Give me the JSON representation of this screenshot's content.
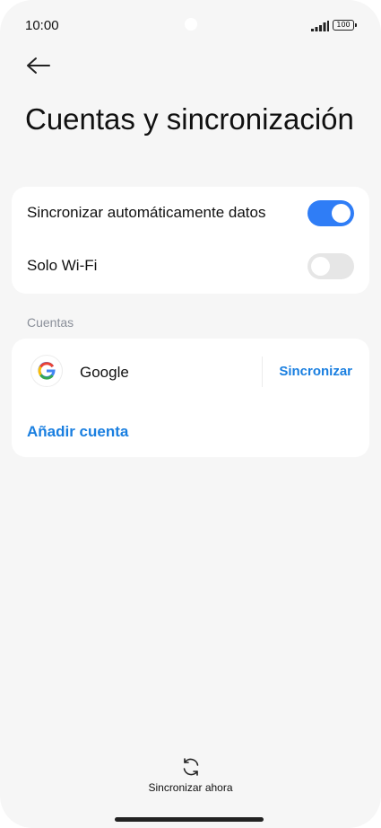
{
  "status_bar": {
    "time": "10:00",
    "battery": "100"
  },
  "header": {
    "title": "Cuentas y sincronización"
  },
  "sync_settings": {
    "items": [
      {
        "label": "Sincronizar automáticamente datos",
        "enabled": true
      },
      {
        "label": "Solo Wi-Fi",
        "enabled": false
      }
    ]
  },
  "accounts": {
    "section_label": "Cuentas",
    "google": {
      "label": "Google",
      "action_label": "Sincronizar"
    },
    "add_account_label": "Añadir cuenta"
  },
  "footer": {
    "sync_now_label": "Sincronizar ahora"
  },
  "colors": {
    "accent": "#2f7df6",
    "link": "#1a7fe0",
    "background": "#f6f6f6"
  },
  "icons": [
    "back-arrow-icon",
    "google-icon",
    "sync-icon",
    "signal-icon",
    "battery-icon"
  ]
}
